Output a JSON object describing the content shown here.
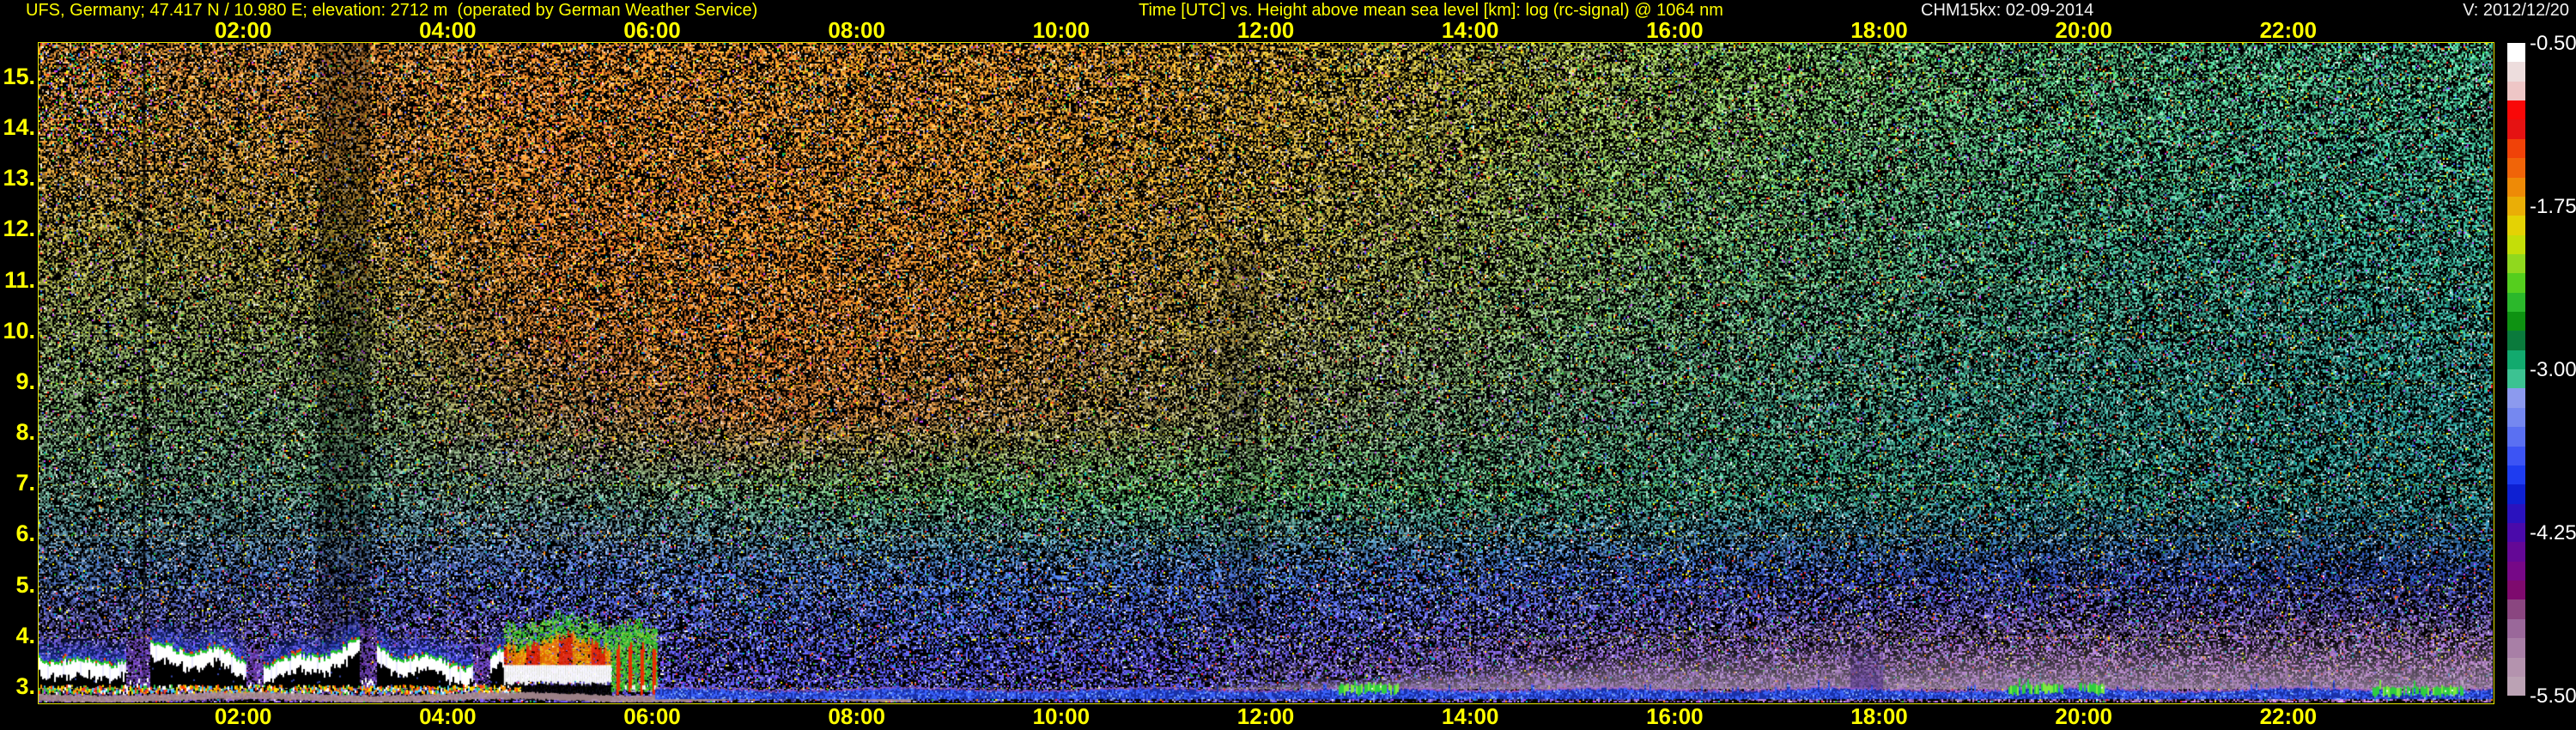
{
  "header": {
    "left": "UFS, Germany; 47.417 N / 10.980 E; elevation: 2712 m  (operated by German Weather Service)",
    "title": "Time [UTC] vs. Height above mean sea level [km]: log (rc-signal) @ 1064 nm",
    "device": "CHM15kx: 02-09-2014",
    "version": "V: 2012/12/20"
  },
  "colors": {
    "background": "#000000",
    "accent_yellow": "#ffff00",
    "text_white": "#f2f2f2",
    "plot_border": "#e8e800",
    "grid": "#ffff00"
  },
  "axes": {
    "x": {
      "unit": "UTC",
      "ticks": [
        "02:00",
        "04:00",
        "06:00",
        "08:00",
        "10:00",
        "12:00",
        "14:00",
        "16:00",
        "18:00",
        "20:00",
        "22:00"
      ],
      "hours": [
        2,
        4,
        6,
        8,
        10,
        12,
        14,
        16,
        18,
        20,
        22
      ],
      "range_hours": [
        0,
        24
      ]
    },
    "y": {
      "unit": "km above mean sea level",
      "ticks": [
        15,
        14,
        13,
        12,
        11,
        10,
        9,
        8,
        7,
        6,
        5,
        4,
        3
      ],
      "tick_suffix": ".",
      "range_km": [
        2.712,
        15.69
      ]
    }
  },
  "colorbar": {
    "ticks": [
      "-0.50",
      "-1.75",
      "-3.00",
      "-4.25",
      "-5.50"
    ],
    "values": [
      -0.5,
      -1.75,
      -3.0,
      -4.25,
      -5.5
    ],
    "range": [
      -0.5,
      -5.5
    ],
    "colors": [
      "#ffffff",
      "#eddddd",
      "#eec6c6",
      "#f90808",
      "#e51212",
      "#f04208",
      "#f06408",
      "#ee8a06",
      "#eaae06",
      "#e4d204",
      "#c4de08",
      "#90d81e",
      "#55ce1e",
      "#2bb82b",
      "#0e9212",
      "#0a7a3c",
      "#12aa6e",
      "#3cc292",
      "#8c9aee",
      "#7588f0",
      "#5a70f2",
      "#3c54f4",
      "#1e3cf0",
      "#0e20d2",
      "#2a12be",
      "#4a0aaa",
      "#640896",
      "#760887",
      "#7e0a6e",
      "#8a4680",
      "#9a689a",
      "#a87fa6",
      "#b493ae",
      "#bba2b4"
    ]
  },
  "chart_data": {
    "type": "heatmap",
    "title": "Time [UTC] vs. Height above mean sea level [km]: log (rc-signal) @ 1064 nm",
    "x_unit": "hours UTC",
    "xlim": [
      0,
      24
    ],
    "ylim_km": [
      2.712,
      15.69
    ],
    "colorbar_range": [
      -0.5,
      -5.5
    ],
    "grid": "dashed yellow, 2-hourly vertical, 1-km horizontal",
    "noise": {
      "cols": 12,
      "rows": 8,
      "density": 0.56,
      "tints": [
        [
          "#b87830",
          "#c07830",
          "#e07828",
          "#e08028",
          "#d88028",
          "#c08428",
          "#a89030",
          "#889840",
          "#68a050",
          "#50a068",
          "#44a074",
          "#3ca07a"
        ],
        [
          "#a87c30",
          "#b07c2c",
          "#d87428",
          "#e07c28",
          "#d07c28",
          "#b88428",
          "#988c38",
          "#78984a",
          "#5c9c5c",
          "#489a6c",
          "#3c9876",
          "#34987c"
        ],
        [
          "#8c8438",
          "#948032",
          "#c87028",
          "#d87828",
          "#c47828",
          "#a88030",
          "#8a8c42",
          "#6c9452",
          "#529662",
          "#409270",
          "#369078",
          "#30907c"
        ],
        [
          "#74884c",
          "#788448",
          "#b06828",
          "#c87028",
          "#b47028",
          "#987c38",
          "#7c8850",
          "#60905c",
          "#4a8e6a",
          "#3a8a72",
          "#328878",
          "#2c887c"
        ],
        [
          "#608458",
          "#5c8458",
          "#8c7040",
          "#b06830",
          "#9c7038",
          "#847c48",
          "#6a845c",
          "#528866",
          "#408870",
          "#348476",
          "#2e827a",
          "#28807c"
        ],
        [
          "#4c7c6c",
          "#4c8070",
          "#5c8474",
          "#549066",
          "#4c945c",
          "#4c9858",
          "#469060",
          "#3e8c68",
          "#34866e",
          "#2e8274",
          "#2a7e76",
          "#267c78"
        ],
        [
          "#3c5890",
          "#4058a0",
          "#4458b0",
          "#4060b0",
          "#3c60b8",
          "#3c5cb8",
          "#3c58b4",
          "#3850ac",
          "#3448a4",
          "#30409c",
          "#2c3c94",
          "#28388c"
        ],
        [
          "#5c3c94",
          "#643fa2",
          "#5440b0",
          "#4846bc",
          "#4646c0",
          "#4a44b8",
          "#5844ac",
          "#6c4aa4",
          "#7c52a2",
          "#8858a2",
          "#8c5ca2",
          "#905ea2"
        ]
      ]
    },
    "features": {
      "stratus_deck": {
        "t_start": 0,
        "t_end": 4.55,
        "top_km_mean": 3.62,
        "note": "broken low cloud, bright white returns with green/red rims, blue glow above, black attenuation shadow below"
      },
      "precip_event": {
        "t_start": 4.55,
        "t_end": 5.6,
        "green_top_km": 4.35,
        "white_band_km": [
          3.14,
          3.45
        ],
        "note": "strong orange/red echo over white band with green fringe"
      },
      "virga_columns": {
        "t_start": 5.6,
        "t_end": 6.05,
        "top_km": 4.25,
        "note": "green columns with red streaks reaching near surface"
      },
      "gap_column_t": 1.02,
      "dim_band": {
        "t_start": 2.73,
        "t_end": 3.25
      },
      "dim_band2": {
        "t_start": 11.55,
        "t_end": 11.95
      },
      "surface_layer": {
        "t_start": 5.9,
        "t_end": 24,
        "height_km": 3.0,
        "note": "thin dark-blue aerosol layer with purple fringe"
      },
      "green_patches_t": [
        [
          12.7,
          13.3
        ],
        [
          19.25,
          19.8
        ],
        [
          19.95,
          20.2
        ],
        [
          22.8,
          23.7
        ]
      ],
      "haze_band": {
        "t_start": 11.5,
        "t_end": 24,
        "top_km_points": [
          [
            11.5,
            3.05
          ],
          [
            13,
            3.25
          ],
          [
            14,
            3.5
          ],
          [
            16,
            3.78
          ],
          [
            18,
            3.93
          ],
          [
            24,
            3.98
          ]
        ],
        "color": "#a78fb0"
      },
      "dark_plume": {
        "t_start": 17.72,
        "t_end": 18.03,
        "top_km": 3.78,
        "color": "#3c1e82"
      },
      "mauve_strip": {
        "t_start": 0,
        "t_end": 8.52,
        "color": "#b29298"
      },
      "palette": {
        "cloud_white": "#ffffff",
        "rim_green": "#22cc22",
        "rim_red": "#ff3c00",
        "glow_blue": "#2d50ff",
        "gap_purple": "#7846c8",
        "precip_orange": "#ff7a00",
        "precip_red": "#f02800",
        "precip_yellow": "#ffc800",
        "precip_green": "#2ec82e",
        "precip_green2": "#8ce03c",
        "surface_dark_blue": "#1830a8",
        "surface_blue": "#3c64ff",
        "surface_light": "#88b4ff",
        "surface_purple": "#a05ad2",
        "patch_green": "#2ecc40",
        "patch_green2": "#80e840",
        "aerosol_line": [
          "#ff4010",
          "#ff9800",
          "#ffe000",
          "#30c840",
          "#ffffff",
          "#40c8ff"
        ]
      }
    }
  }
}
